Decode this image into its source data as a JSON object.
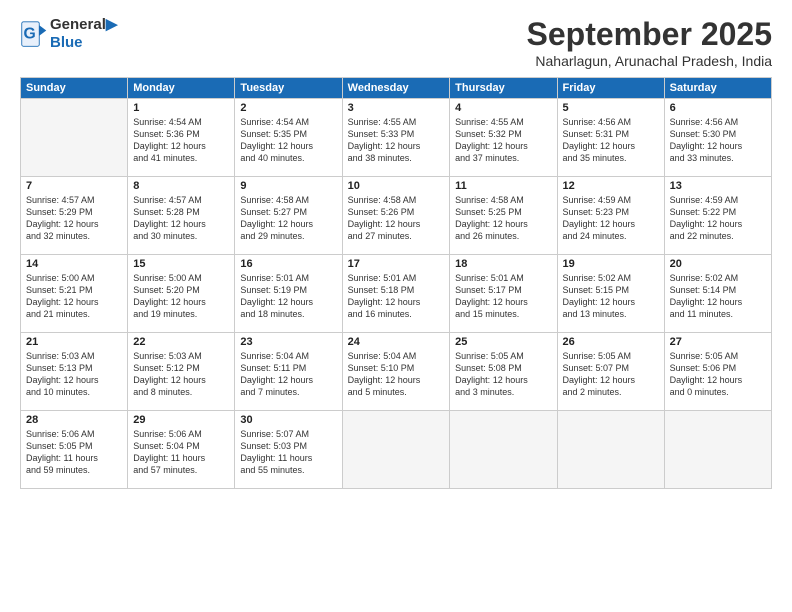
{
  "logo": {
    "line1": "General",
    "line2": "Blue"
  },
  "title": "September 2025",
  "subtitle": "Naharlagun, Arunachal Pradesh, India",
  "days_header": [
    "Sunday",
    "Monday",
    "Tuesday",
    "Wednesday",
    "Thursday",
    "Friday",
    "Saturday"
  ],
  "weeks": [
    [
      {
        "day": "",
        "info": ""
      },
      {
        "day": "1",
        "info": "Sunrise: 4:54 AM\nSunset: 5:36 PM\nDaylight: 12 hours\nand 41 minutes."
      },
      {
        "day": "2",
        "info": "Sunrise: 4:54 AM\nSunset: 5:35 PM\nDaylight: 12 hours\nand 40 minutes."
      },
      {
        "day": "3",
        "info": "Sunrise: 4:55 AM\nSunset: 5:33 PM\nDaylight: 12 hours\nand 38 minutes."
      },
      {
        "day": "4",
        "info": "Sunrise: 4:55 AM\nSunset: 5:32 PM\nDaylight: 12 hours\nand 37 minutes."
      },
      {
        "day": "5",
        "info": "Sunrise: 4:56 AM\nSunset: 5:31 PM\nDaylight: 12 hours\nand 35 minutes."
      },
      {
        "day": "6",
        "info": "Sunrise: 4:56 AM\nSunset: 5:30 PM\nDaylight: 12 hours\nand 33 minutes."
      }
    ],
    [
      {
        "day": "7",
        "info": "Sunrise: 4:57 AM\nSunset: 5:29 PM\nDaylight: 12 hours\nand 32 minutes."
      },
      {
        "day": "8",
        "info": "Sunrise: 4:57 AM\nSunset: 5:28 PM\nDaylight: 12 hours\nand 30 minutes."
      },
      {
        "day": "9",
        "info": "Sunrise: 4:58 AM\nSunset: 5:27 PM\nDaylight: 12 hours\nand 29 minutes."
      },
      {
        "day": "10",
        "info": "Sunrise: 4:58 AM\nSunset: 5:26 PM\nDaylight: 12 hours\nand 27 minutes."
      },
      {
        "day": "11",
        "info": "Sunrise: 4:58 AM\nSunset: 5:25 PM\nDaylight: 12 hours\nand 26 minutes."
      },
      {
        "day": "12",
        "info": "Sunrise: 4:59 AM\nSunset: 5:23 PM\nDaylight: 12 hours\nand 24 minutes."
      },
      {
        "day": "13",
        "info": "Sunrise: 4:59 AM\nSunset: 5:22 PM\nDaylight: 12 hours\nand 22 minutes."
      }
    ],
    [
      {
        "day": "14",
        "info": "Sunrise: 5:00 AM\nSunset: 5:21 PM\nDaylight: 12 hours\nand 21 minutes."
      },
      {
        "day": "15",
        "info": "Sunrise: 5:00 AM\nSunset: 5:20 PM\nDaylight: 12 hours\nand 19 minutes."
      },
      {
        "day": "16",
        "info": "Sunrise: 5:01 AM\nSunset: 5:19 PM\nDaylight: 12 hours\nand 18 minutes."
      },
      {
        "day": "17",
        "info": "Sunrise: 5:01 AM\nSunset: 5:18 PM\nDaylight: 12 hours\nand 16 minutes."
      },
      {
        "day": "18",
        "info": "Sunrise: 5:01 AM\nSunset: 5:17 PM\nDaylight: 12 hours\nand 15 minutes."
      },
      {
        "day": "19",
        "info": "Sunrise: 5:02 AM\nSunset: 5:15 PM\nDaylight: 12 hours\nand 13 minutes."
      },
      {
        "day": "20",
        "info": "Sunrise: 5:02 AM\nSunset: 5:14 PM\nDaylight: 12 hours\nand 11 minutes."
      }
    ],
    [
      {
        "day": "21",
        "info": "Sunrise: 5:03 AM\nSunset: 5:13 PM\nDaylight: 12 hours\nand 10 minutes."
      },
      {
        "day": "22",
        "info": "Sunrise: 5:03 AM\nSunset: 5:12 PM\nDaylight: 12 hours\nand 8 minutes."
      },
      {
        "day": "23",
        "info": "Sunrise: 5:04 AM\nSunset: 5:11 PM\nDaylight: 12 hours\nand 7 minutes."
      },
      {
        "day": "24",
        "info": "Sunrise: 5:04 AM\nSunset: 5:10 PM\nDaylight: 12 hours\nand 5 minutes."
      },
      {
        "day": "25",
        "info": "Sunrise: 5:05 AM\nSunset: 5:08 PM\nDaylight: 12 hours\nand 3 minutes."
      },
      {
        "day": "26",
        "info": "Sunrise: 5:05 AM\nSunset: 5:07 PM\nDaylight: 12 hours\nand 2 minutes."
      },
      {
        "day": "27",
        "info": "Sunrise: 5:05 AM\nSunset: 5:06 PM\nDaylight: 12 hours\nand 0 minutes."
      }
    ],
    [
      {
        "day": "28",
        "info": "Sunrise: 5:06 AM\nSunset: 5:05 PM\nDaylight: 11 hours\nand 59 minutes."
      },
      {
        "day": "29",
        "info": "Sunrise: 5:06 AM\nSunset: 5:04 PM\nDaylight: 11 hours\nand 57 minutes."
      },
      {
        "day": "30",
        "info": "Sunrise: 5:07 AM\nSunset: 5:03 PM\nDaylight: 11 hours\nand 55 minutes."
      },
      {
        "day": "",
        "info": ""
      },
      {
        "day": "",
        "info": ""
      },
      {
        "day": "",
        "info": ""
      },
      {
        "day": "",
        "info": ""
      }
    ]
  ]
}
